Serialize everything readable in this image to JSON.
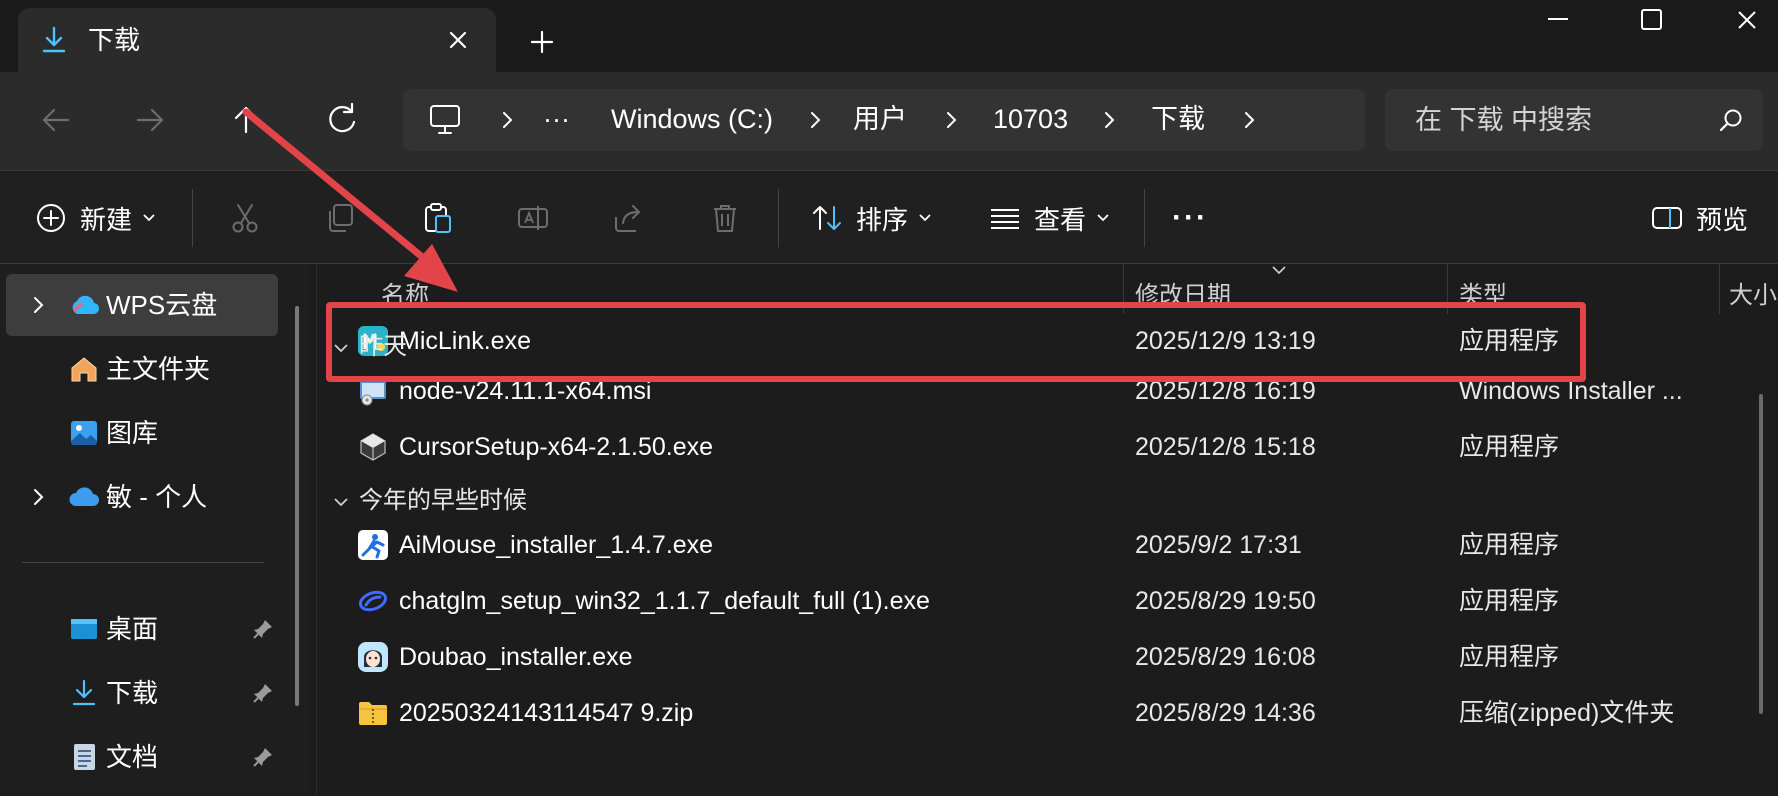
{
  "window": {
    "tab_title": "下载"
  },
  "address": {
    "breadcrumb": [
      "Windows (C:)",
      "用户",
      "10703",
      "下载"
    ],
    "ellipsis": "···",
    "search_placeholder": "在 下载 中搜索"
  },
  "toolbar": {
    "new_label": "新建",
    "sort_label": "排序",
    "view_label": "查看",
    "more_label": "···",
    "preview_label": "预览"
  },
  "sidebar": {
    "items": [
      {
        "label": "WPS云盘",
        "icon": "cloud-icon"
      },
      {
        "label": "主文件夹",
        "icon": "home-icon"
      },
      {
        "label": "图库",
        "icon": "gallery-icon"
      },
      {
        "label": "敏 - 个人",
        "icon": "onedrive-icon"
      },
      {
        "label": "桌面",
        "icon": "desktop-icon"
      },
      {
        "label": "下载",
        "icon": "download-icon"
      },
      {
        "label": "文档",
        "icon": "document-icon"
      }
    ]
  },
  "columns": {
    "name": "名称",
    "date": "修改日期",
    "type": "类型",
    "size": "大小"
  },
  "groups": {
    "yesterday": "昨天",
    "earlier_this_year": "今年的早些时候"
  },
  "files": [
    {
      "name": "MicLink.exe",
      "date": "2025/12/9 13:19",
      "type": "应用程序",
      "icon": "miclink-icon"
    },
    {
      "name": "node-v24.11.1-x64.msi",
      "date": "2025/12/8 16:19",
      "type": "Windows Installer ...",
      "icon": "msi-installer-icon"
    },
    {
      "name": "CursorSetup-x64-2.1.50.exe",
      "date": "2025/12/8 15:18",
      "type": "应用程序",
      "icon": "cursor-icon"
    },
    {
      "name": "AiMouse_installer_1.4.7.exe",
      "date": "2025/9/2 17:31",
      "type": "应用程序",
      "icon": "aimouse-icon"
    },
    {
      "name": "chatglm_setup_win32_1.1.7_default_full (1).exe",
      "date": "2025/8/29 19:50",
      "type": "应用程序",
      "icon": "chatglm-icon"
    },
    {
      "name": "Doubao_installer.exe",
      "date": "2025/8/29 16:08",
      "type": "应用程序",
      "icon": "doubao-icon"
    },
    {
      "name": "20250324143114547 9.zip",
      "date": "2025/8/29 14:36",
      "type": "压缩(zipped)文件夹",
      "icon": "zip-folder-icon"
    }
  ],
  "colors": {
    "annotation": "#e3444a",
    "accent": "#4cc2ff"
  }
}
